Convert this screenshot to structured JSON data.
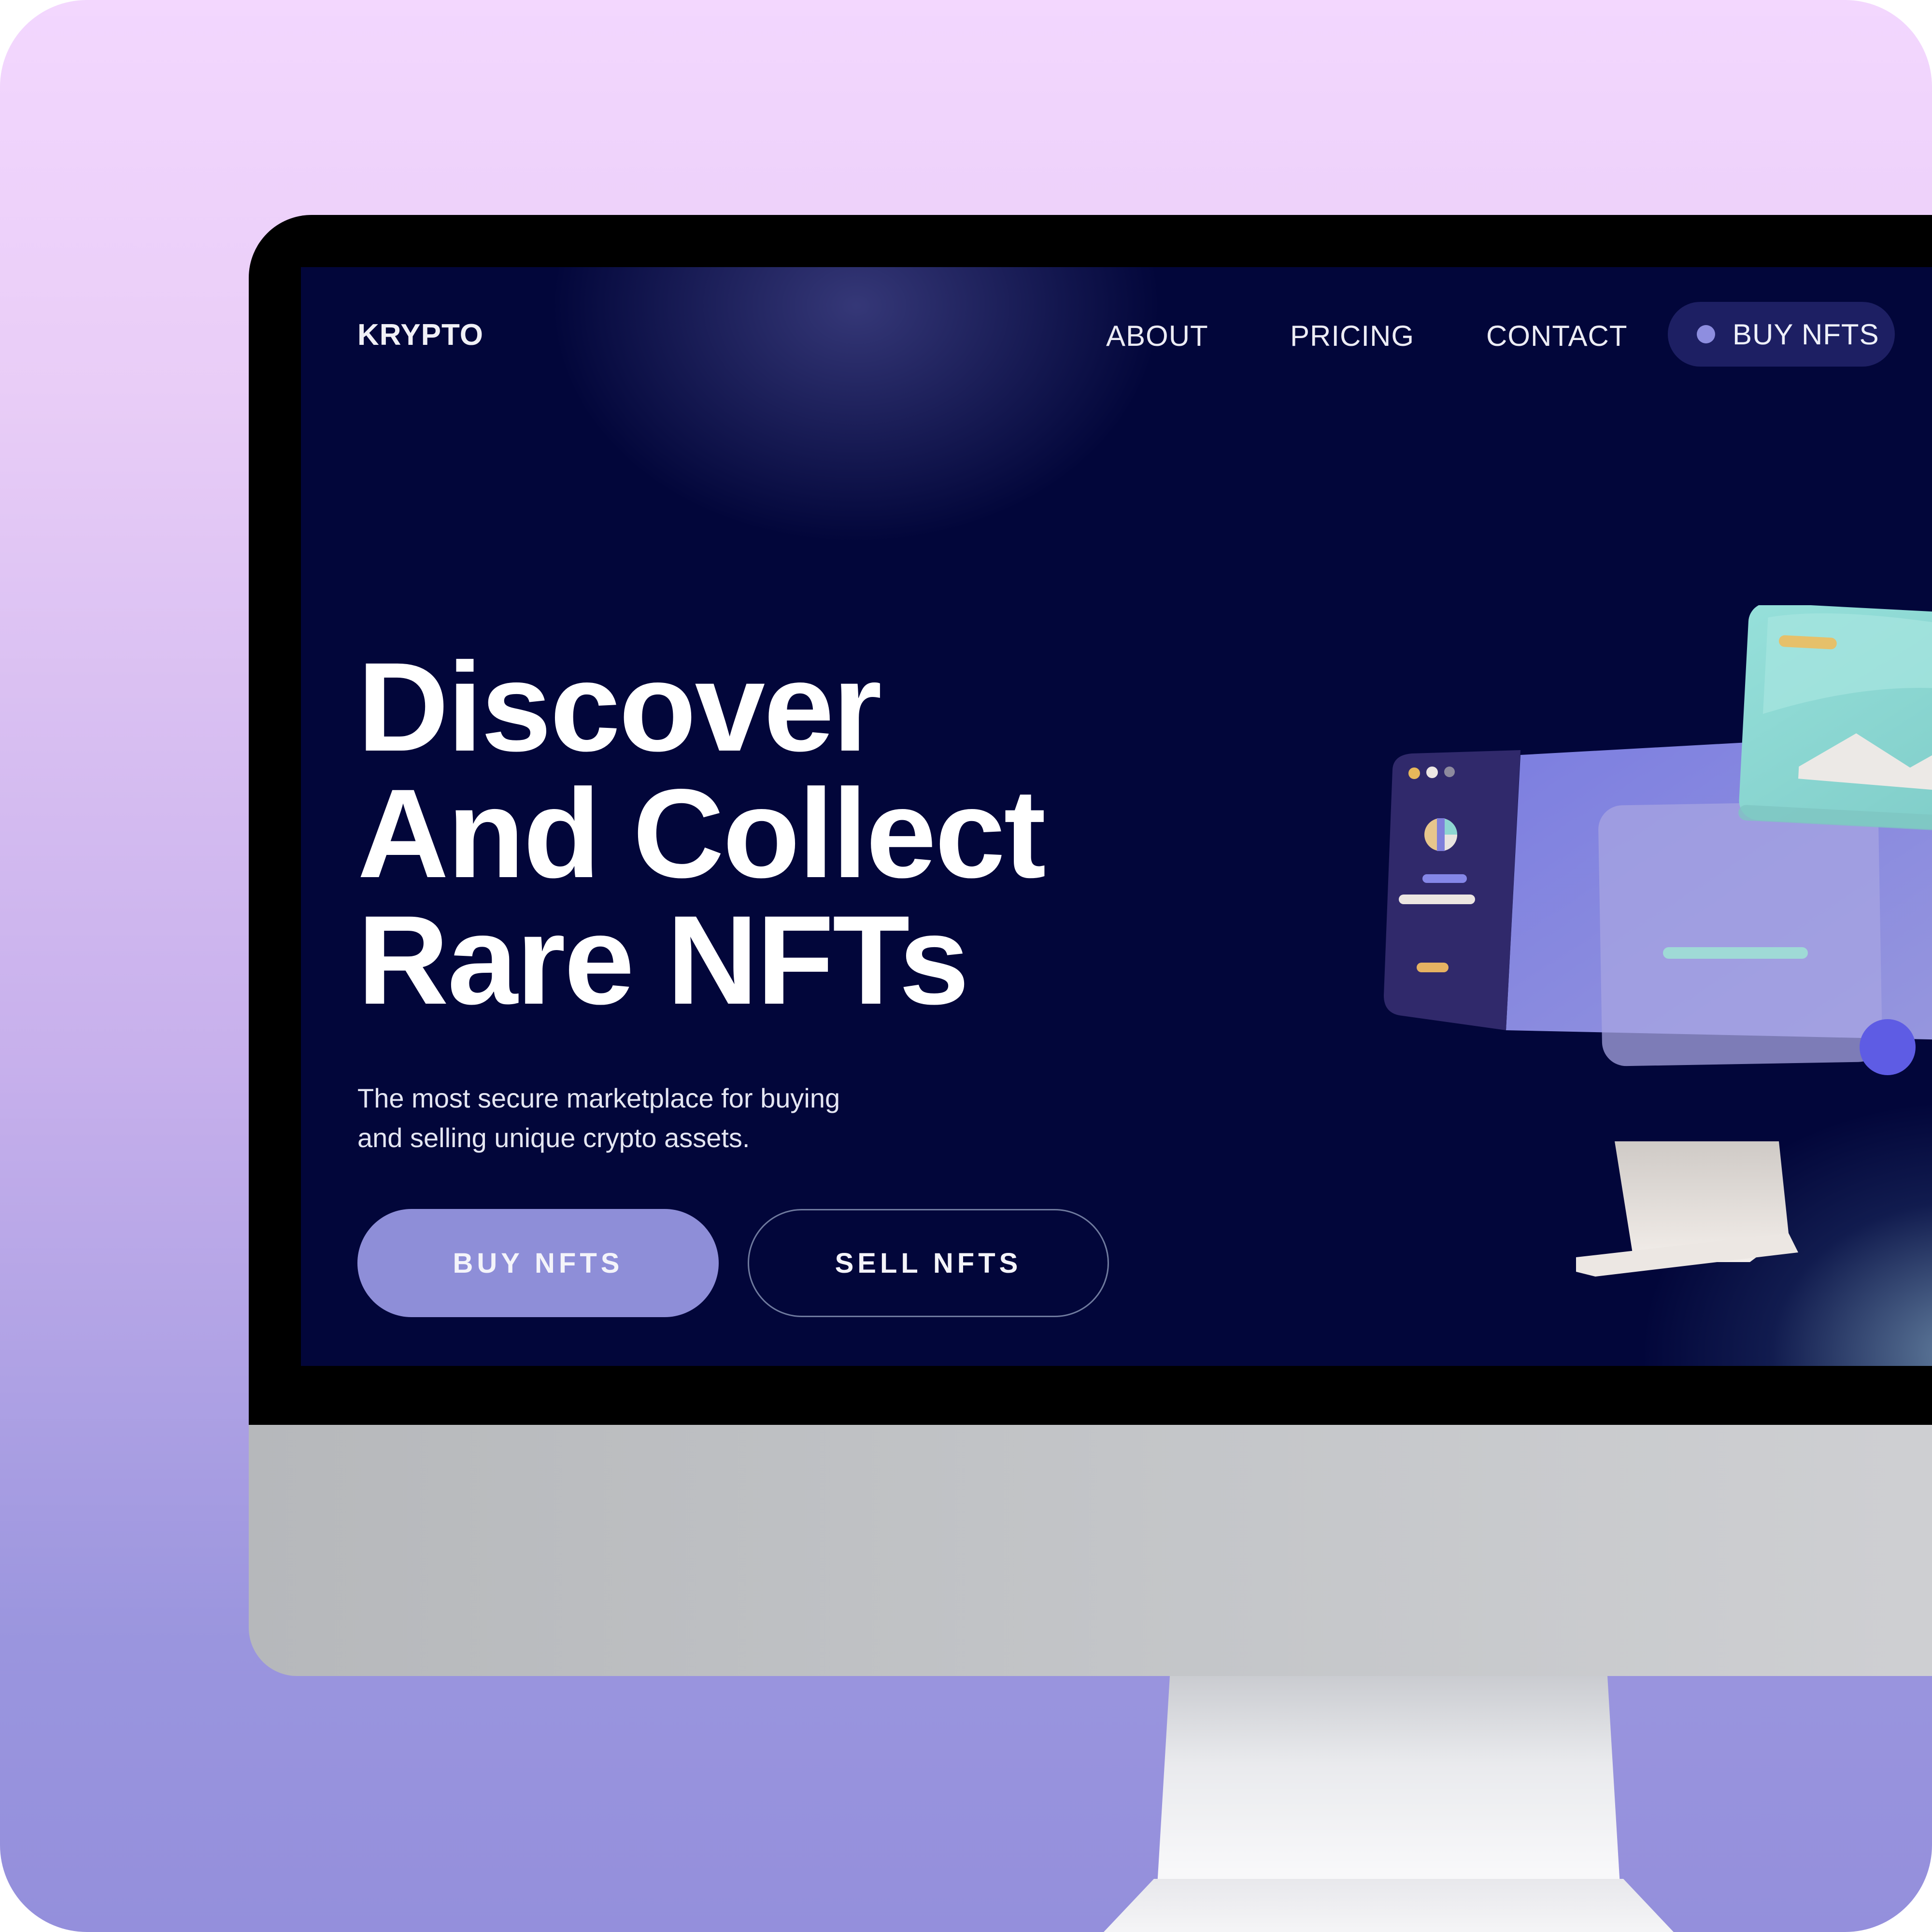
{
  "nav": {
    "logo": "KRYPTO",
    "links": [
      "ABOUT",
      "PRICING",
      "CONTACT"
    ],
    "cta_label": "BUY NFTS"
  },
  "hero": {
    "title_lines": [
      "Discover",
      "And Collect",
      "Rare NFTs"
    ],
    "subtitle_lines": [
      "The most secure marketplace for buying",
      "and selling unique crypto assets."
    ],
    "primary_button": "BUY NFTS",
    "secondary_button": "SELL NFTS"
  },
  "colors": {
    "screen_background": "#02063a",
    "accent": "#8e8ed8",
    "nav_pill": "#1d1f63",
    "teal": "#8ed6d2",
    "frame_bezel": "#000000",
    "frame_chin": "#c3c5c8"
  },
  "illustration": {
    "icon": "monitor-with-image-card-illustration"
  }
}
